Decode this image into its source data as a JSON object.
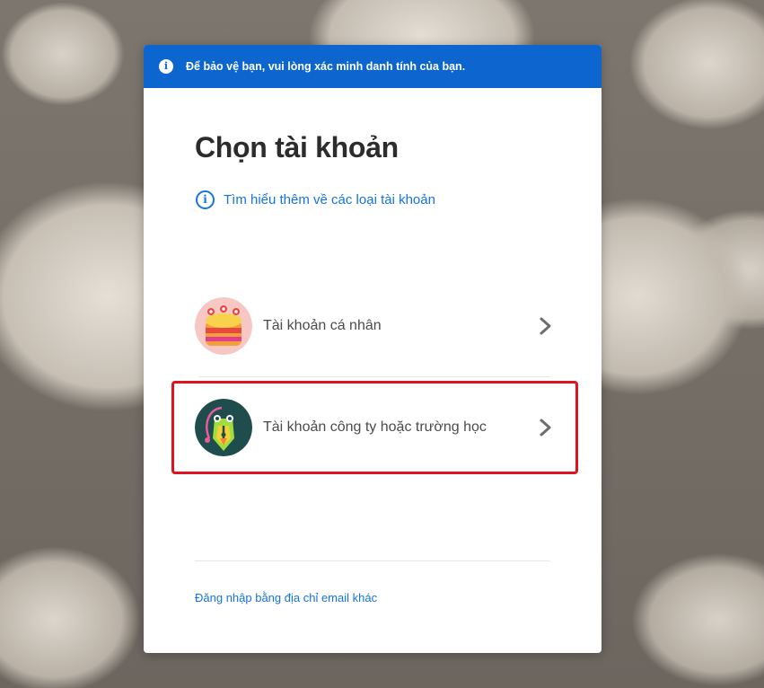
{
  "banner": {
    "text": "Để bảo vệ bạn, vui lòng xác minh danh tính của bạn.",
    "icon": "info-icon"
  },
  "heading": "Chọn tài khoản",
  "learn_more": {
    "text": "Tìm hiểu thêm về các loại tài khoản",
    "icon": "info-icon"
  },
  "accounts": [
    {
      "label": "Tài khoản cá nhân",
      "icon": "personal-account-avatar"
    },
    {
      "label": "Tài khoản công ty hoặc trường học",
      "icon": "business-account-avatar"
    }
  ],
  "other_email_link": "Đăng nhập bằng địa chỉ email khác",
  "colors": {
    "accent": "#0d66d0",
    "link": "#1473e6",
    "highlight": "#e0141e"
  }
}
